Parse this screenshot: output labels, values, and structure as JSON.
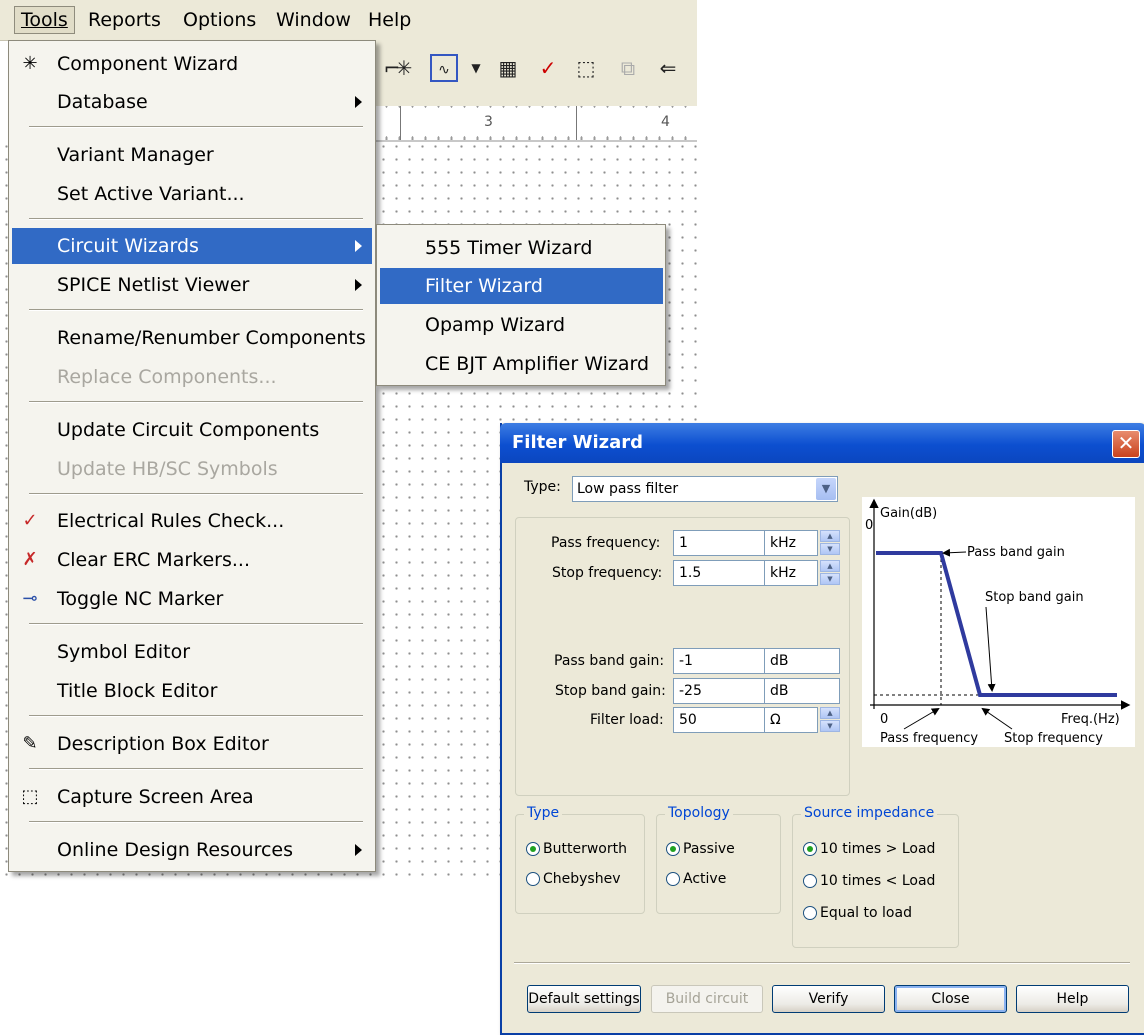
{
  "menubar": {
    "items": [
      "Tools",
      "Reports",
      "Options",
      "Window",
      "Help"
    ]
  },
  "ruler": {
    "ticks": [
      "3",
      "4"
    ]
  },
  "tools_menu": {
    "items": [
      {
        "label": "Component Wizard",
        "icon": "component-wizard-icon",
        "state": "normal"
      },
      {
        "label": "Database",
        "submenu": true,
        "state": "normal"
      },
      {
        "label": "Variant Manager",
        "state": "normal"
      },
      {
        "label": "Set Active Variant...",
        "state": "normal"
      },
      {
        "label": "Circuit Wizards",
        "submenu": true,
        "state": "highlighted"
      },
      {
        "label": "SPICE Netlist Viewer",
        "submenu": true,
        "state": "normal"
      },
      {
        "label": "Rename/Renumber Components",
        "state": "normal"
      },
      {
        "label": "Replace Components...",
        "state": "disabled"
      },
      {
        "label": "Update Circuit Components",
        "state": "normal"
      },
      {
        "label": "Update HB/SC Symbols",
        "state": "disabled"
      },
      {
        "label": "Electrical Rules Check...",
        "icon": "erc-check-icon",
        "state": "normal"
      },
      {
        "label": "Clear ERC Markers...",
        "icon": "clear-erc-icon",
        "state": "normal"
      },
      {
        "label": "Toggle NC Marker",
        "icon": "nc-marker-icon",
        "state": "normal"
      },
      {
        "label": "Symbol Editor",
        "state": "normal"
      },
      {
        "label": "Title Block Editor",
        "state": "normal"
      },
      {
        "label": "Description Box Editor",
        "icon": "description-box-icon",
        "state": "normal"
      },
      {
        "label": "Capture Screen Area",
        "icon": "capture-area-icon",
        "state": "normal"
      },
      {
        "label": "Online Design Resources",
        "submenu": true,
        "state": "normal"
      }
    ]
  },
  "circuit_wizards_submenu": {
    "items": [
      {
        "label": "555 Timer Wizard",
        "state": "normal"
      },
      {
        "label": "Filter Wizard",
        "state": "highlighted"
      },
      {
        "label": "Opamp Wizard",
        "state": "normal"
      },
      {
        "label": "CE BJT Amplifier Wizard",
        "state": "normal"
      }
    ]
  },
  "dialog": {
    "title": "Filter Wizard",
    "type_label": "Type:",
    "type_value": "Low pass filter",
    "fields": [
      {
        "label": "Pass frequency:",
        "value": "1",
        "unit": "kHz"
      },
      {
        "label": "Stop frequency:",
        "value": "1.5",
        "unit": "kHz"
      },
      {
        "label": "Pass band gain:",
        "value": "-1",
        "unit": "dB"
      },
      {
        "label": "Stop band gain:",
        "value": "-25",
        "unit": "dB"
      },
      {
        "label": "Filter load:",
        "value": "50",
        "unit": "Ω"
      }
    ],
    "graph": {
      "y_axis": "Gain(dB)",
      "y_zero": "0",
      "x_zero": "0",
      "x_axis": "Freq.(Hz)",
      "pass_band_gain": "Pass band gain",
      "stop_band_gain": "Stop band gain",
      "pass_frequency": "Pass frequency",
      "stop_frequency": "Stop frequency",
      "line_color": "#2f3a9e"
    },
    "type_group": {
      "legend": "Type",
      "options": [
        {
          "label": "Butterworth",
          "selected": true
        },
        {
          "label": "Chebyshev",
          "selected": false
        }
      ]
    },
    "topology_group": {
      "legend": "Topology",
      "options": [
        {
          "label": "Passive",
          "selected": true
        },
        {
          "label": "Active",
          "selected": false
        }
      ]
    },
    "source_group": {
      "legend": "Source impedance",
      "options": [
        {
          "label": "10 times > Load",
          "selected": true
        },
        {
          "label": "10 times < Load",
          "selected": false
        },
        {
          "label": "Equal to load",
          "selected": false
        }
      ]
    },
    "buttons": {
      "default_settings": "Default settings",
      "build_circuit": "Build circuit",
      "verify": "Verify",
      "close": "Close",
      "help": "Help"
    }
  },
  "colors": {
    "highlight": "#316ac5",
    "titlebar": "#0c4fd0",
    "dialog_bg": "#ece9d8"
  }
}
